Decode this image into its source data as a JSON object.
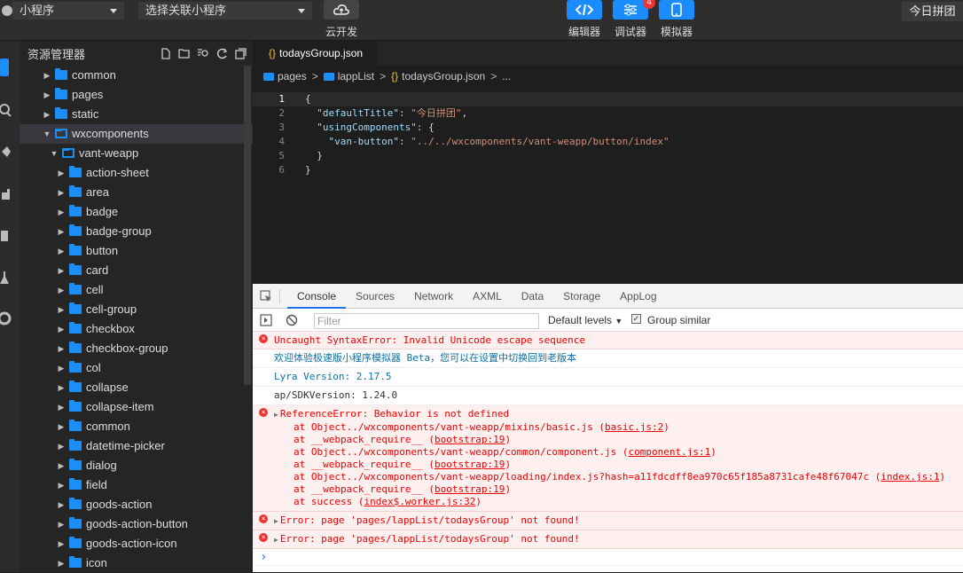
{
  "topbar": {
    "project_select": "小程序",
    "related_select": "选择关联小程序",
    "cloud_label": "云开发",
    "editor_label": "编辑器",
    "debugger_label": "调试器",
    "debugger_badge": "4",
    "simulator_label": "模拟器",
    "project_name": "今日拼团"
  },
  "explorer": {
    "title": "资源管理器",
    "items": [
      {
        "label": "common",
        "depth": 1,
        "open": false
      },
      {
        "label": "pages",
        "depth": 1,
        "open": false
      },
      {
        "label": "static",
        "depth": 1,
        "open": false
      },
      {
        "label": "wxcomponents",
        "depth": 1,
        "open": true
      },
      {
        "label": "vant-weapp",
        "depth": 2,
        "open": true
      },
      {
        "label": "action-sheet",
        "depth": 3,
        "open": false
      },
      {
        "label": "area",
        "depth": 3,
        "open": false
      },
      {
        "label": "badge",
        "depth": 3,
        "open": false
      },
      {
        "label": "badge-group",
        "depth": 3,
        "open": false
      },
      {
        "label": "button",
        "depth": 3,
        "open": false
      },
      {
        "label": "card",
        "depth": 3,
        "open": false
      },
      {
        "label": "cell",
        "depth": 3,
        "open": false
      },
      {
        "label": "cell-group",
        "depth": 3,
        "open": false
      },
      {
        "label": "checkbox",
        "depth": 3,
        "open": false
      },
      {
        "label": "checkbox-group",
        "depth": 3,
        "open": false
      },
      {
        "label": "col",
        "depth": 3,
        "open": false
      },
      {
        "label": "collapse",
        "depth": 3,
        "open": false
      },
      {
        "label": "collapse-item",
        "depth": 3,
        "open": false
      },
      {
        "label": "common",
        "depth": 3,
        "open": false
      },
      {
        "label": "datetime-picker",
        "depth": 3,
        "open": false
      },
      {
        "label": "dialog",
        "depth": 3,
        "open": false
      },
      {
        "label": "field",
        "depth": 3,
        "open": false
      },
      {
        "label": "goods-action",
        "depth": 3,
        "open": false
      },
      {
        "label": "goods-action-button",
        "depth": 3,
        "open": false
      },
      {
        "label": "goods-action-icon",
        "depth": 3,
        "open": false
      },
      {
        "label": "icon",
        "depth": 3,
        "open": false
      }
    ]
  },
  "editor": {
    "tab": "todaysGroup.json",
    "breadcrumb": [
      "pages",
      "lappList",
      "todaysGroup.json",
      "..."
    ],
    "lines": [
      {
        "n": "1",
        "text": "{"
      },
      {
        "n": "2",
        "key": "\"defaultTitle\"",
        "rest": ": ",
        "str": "\"今日拼团\"",
        "tail": ","
      },
      {
        "n": "3",
        "key": "\"usingComponents\"",
        "rest": ": {",
        "str": "",
        "tail": ""
      },
      {
        "n": "4",
        "key": "\"van-button\"",
        "rest": ": ",
        "str": "\"../../wxcomponents/vant-weapp/button/index\"",
        "tail": ""
      },
      {
        "n": "5",
        "text": "  }"
      },
      {
        "n": "6",
        "text": "}"
      }
    ]
  },
  "console": {
    "tabs": [
      "Console",
      "Sources",
      "Network",
      "AXML",
      "Data",
      "Storage",
      "AppLog"
    ],
    "filter_placeholder": "Filter",
    "levels": "Default levels",
    "group_similar": "Group similar",
    "messages": [
      {
        "type": "err",
        "text": "Uncaught SyntaxError: Invalid Unicode escape sequence"
      },
      {
        "type": "blue",
        "text": "欢迎体验极速版小程序模拟器 Beta，您可以在设置中切换回到老版本"
      },
      {
        "type": "blue",
        "text": "Lyra Version: 2.17.5"
      },
      {
        "type": "dark",
        "text": "ap/SDKVersion: 1.24.0"
      }
    ],
    "ref_error": {
      "head": "ReferenceError: Behavior is not defined",
      "stack": [
        {
          "text": "at Object../wxcomponents/vant-weapp/mixins/basic.js (",
          "link": "basic.js:2",
          "end": ")"
        },
        {
          "text": "at __webpack_require__ (",
          "link": "bootstrap:19",
          "end": ")"
        },
        {
          "text": "at Object../wxcomponents/vant-weapp/common/component.js (",
          "link": "component.js:1",
          "end": ")"
        },
        {
          "text": "at __webpack_require__ (",
          "link": "bootstrap:19",
          "end": ")"
        },
        {
          "text": "at Object../wxcomponents/vant-weapp/loading/index.js?hash=a11fdcdff8ea970c65f185a8731cafe48f67047c (",
          "link": "index.js:1",
          "end": ")"
        },
        {
          "text": "at __webpack_require__ (",
          "link": "bootstrap:19",
          "end": ")"
        },
        {
          "text": "at success (",
          "link": "index$.worker.js:32",
          "end": ")"
        }
      ]
    },
    "page_errors": [
      "Error: page 'pages/lappList/todaysGroup' not found!",
      "Error: page 'pages/lappList/todaysGroup' not found!"
    ],
    "prompt": "›"
  }
}
